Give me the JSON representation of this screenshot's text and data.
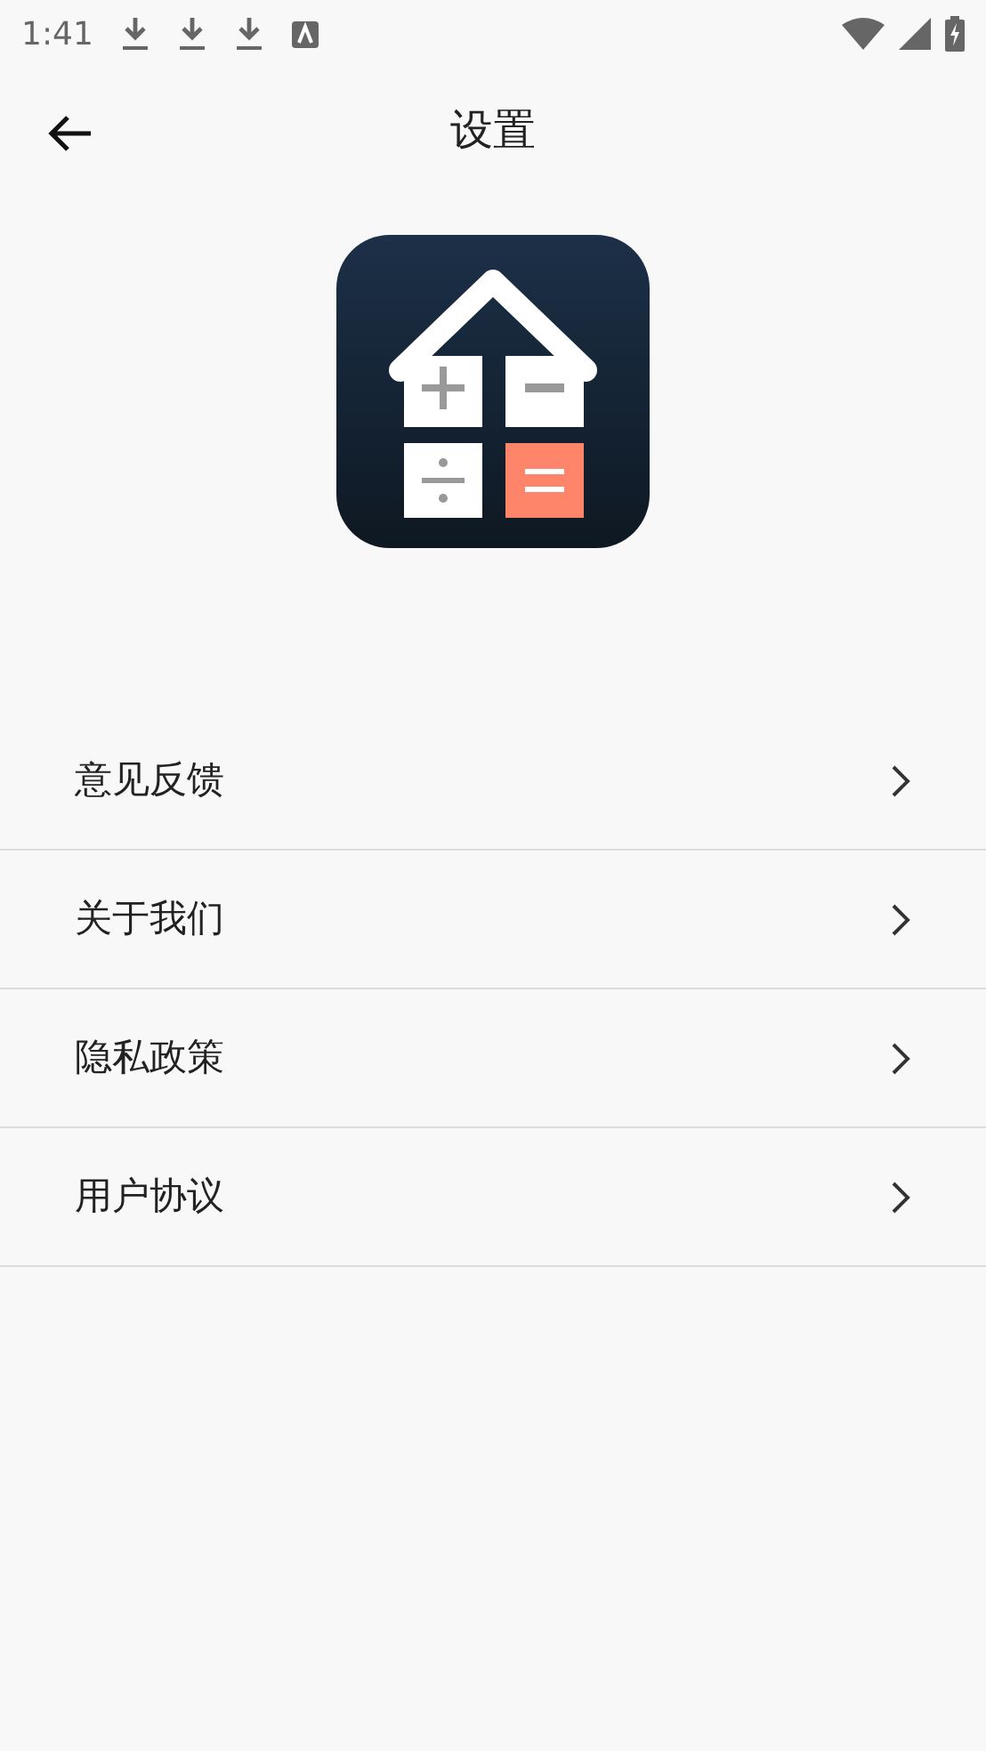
{
  "status_bar": {
    "time": "1:41"
  },
  "header": {
    "title": "设置"
  },
  "menu": [
    {
      "label": "意见反馈"
    },
    {
      "label": "关于我们"
    },
    {
      "label": "隐私政策"
    },
    {
      "label": "用户协议"
    }
  ]
}
